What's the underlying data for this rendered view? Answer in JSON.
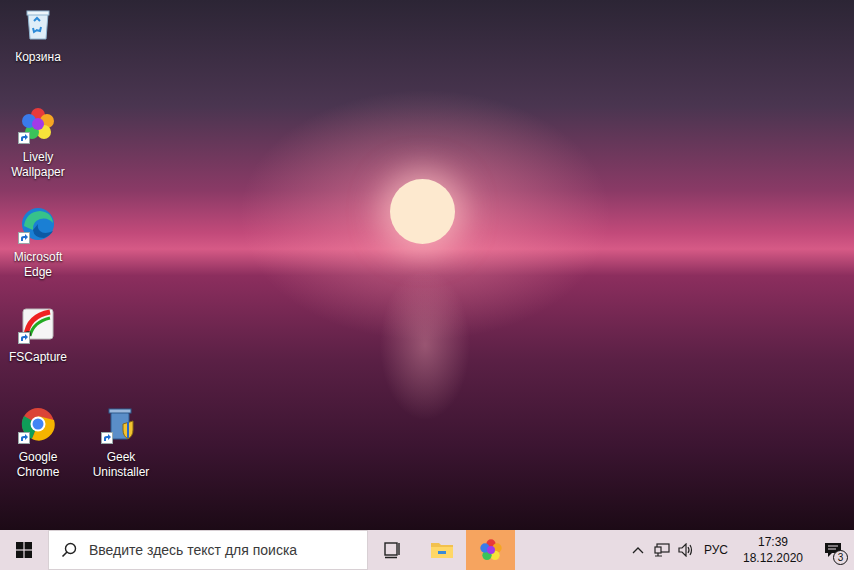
{
  "desktop": {
    "icons": [
      {
        "label": "Корзина",
        "kind": "recycle-bin",
        "shortcut": false
      },
      {
        "label": "Lively Wallpaper",
        "kind": "lively",
        "shortcut": true
      },
      {
        "label": "Microsoft Edge",
        "kind": "edge",
        "shortcut": true
      },
      {
        "label": "FSCapture",
        "kind": "fscapture",
        "shortcut": true
      },
      {
        "label": "Google Chrome",
        "kind": "chrome",
        "shortcut": true
      },
      {
        "label": "Geek Uninstaller",
        "kind": "geek",
        "shortcut": true
      }
    ]
  },
  "taskbar": {
    "search": {
      "placeholder": "Введите здесь текст для поиска"
    },
    "apps": [
      {
        "kind": "task-view",
        "active": false
      },
      {
        "kind": "explorer",
        "active": false
      },
      {
        "kind": "lively",
        "active": true
      }
    ],
    "tray": {
      "language": "РУС",
      "time": "17:39",
      "date": "18.12.2020",
      "notifications": "3"
    }
  }
}
